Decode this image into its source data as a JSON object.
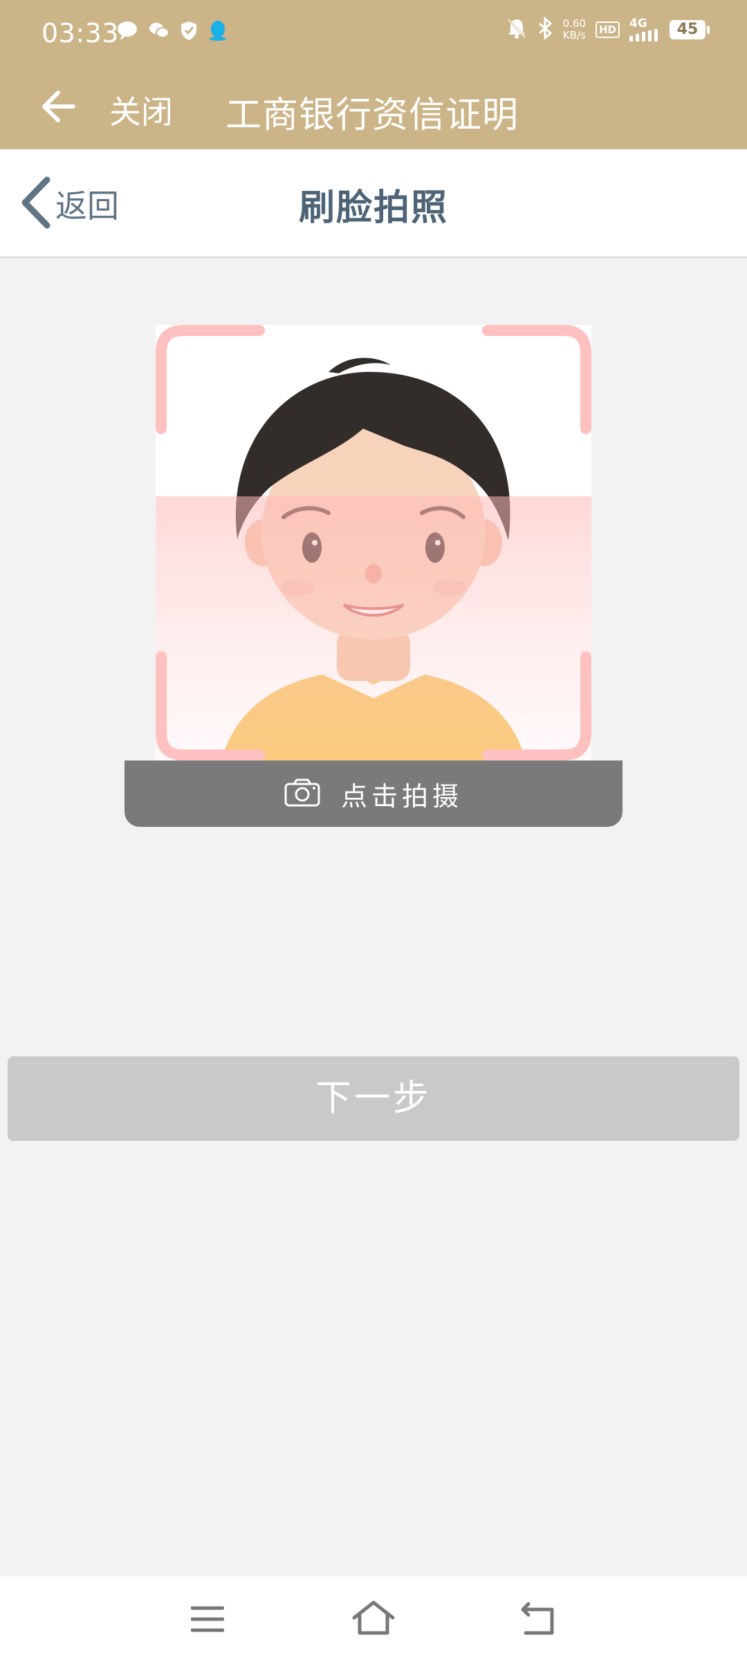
{
  "status_bar": {
    "time": "03:33",
    "net_speed_value": "0.60",
    "net_speed_unit": "KB/s",
    "hd": "HD",
    "network": "4G",
    "battery": "45"
  },
  "title_bar": {
    "close_label": "关闭",
    "title": "工商银行资信证明"
  },
  "sub_header": {
    "back_label": "返回",
    "title": "刷脸拍照"
  },
  "capture": {
    "label": "点击拍摄"
  },
  "next_button": {
    "label": "下一步"
  },
  "colors": {
    "brand_header": "#cbb487",
    "subtitle_text": "#4e6476",
    "frame_corner": "#ffc0c0",
    "capture_bar": "#7a7a7a",
    "disabled_button": "#c9c9c9"
  }
}
